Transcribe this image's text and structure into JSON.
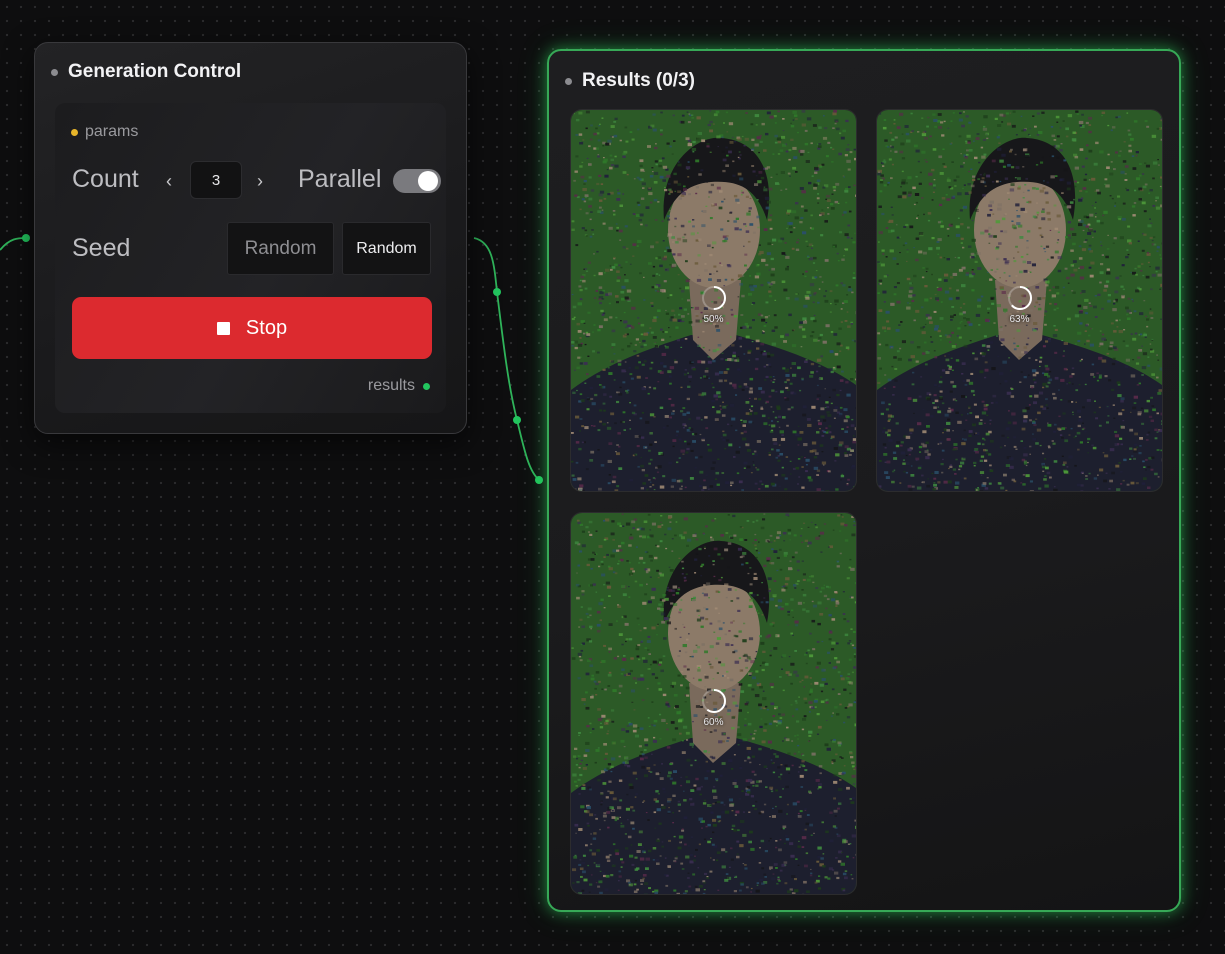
{
  "generation_control": {
    "title": "Generation Control",
    "params_port": "params",
    "count_label": "Count",
    "count_value": "3",
    "parallel_label": "Parallel",
    "parallel_on": true,
    "seed_label": "Seed",
    "seed_placeholder": "Random",
    "seed_button": "Random",
    "stop_label": "Stop",
    "results_port": "results"
  },
  "results": {
    "title": "Results (0/3)",
    "items": [
      {
        "progress": "50%",
        "progress_value": 0.5
      },
      {
        "progress": "63%",
        "progress_value": 0.63
      },
      {
        "progress": "60%",
        "progress_value": 0.6
      }
    ]
  },
  "colors": {
    "accent_green": "#22c55e",
    "stop_red": "#dc2a2f",
    "params_port_yellow": "#e7b52a"
  },
  "icons": [
    "chevron-left-icon",
    "chevron-right-icon",
    "stop-icon",
    "spinner-icon"
  ]
}
